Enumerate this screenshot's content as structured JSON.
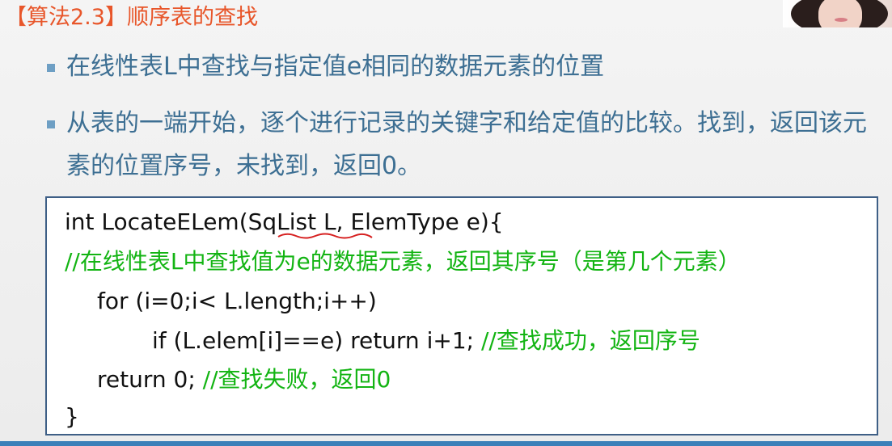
{
  "slide": {
    "title": "【算法2.3】顺序表的查找",
    "bullets": [
      "在线性表L中查找与指定值e相同的数据元素的位置",
      "从表的一端开始，逐个进行记录的关键字和给定值的比较。找到，返回该元素的位置序号，未找到，返回0。"
    ]
  },
  "code": {
    "line1": "int LocateELem(SqList L, ElemType e){",
    "line2_comment": "//在线性表L中查找值为e的数据元素，返回其序号（是第几个元素）",
    "line3": "for (i=0;i< L.length;i++)",
    "line4_code": "if (L.elem[i]==e) return i+1; ",
    "line4_comment": "//查找成功，返回序号",
    "line5_code": "return 0; ",
    "line5_comment": "//查找失败，返回0",
    "line6": "}"
  },
  "colors": {
    "title": "#e8562a",
    "bullet_text": "#3d6f93",
    "comment": "#13b413",
    "annotation_stroke": "#d62020"
  }
}
